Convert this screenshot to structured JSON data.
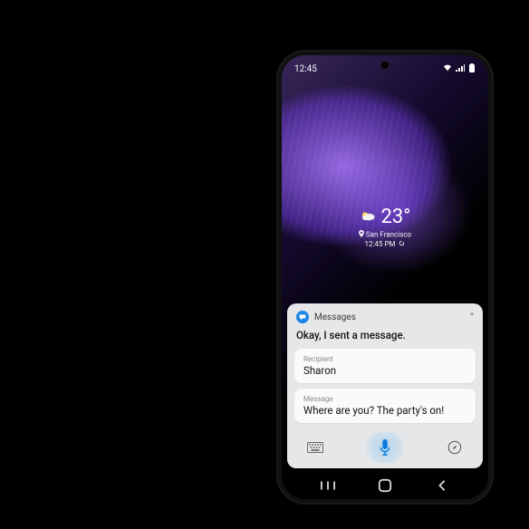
{
  "statusbar": {
    "time": "12:45"
  },
  "widget": {
    "temperature": "23°",
    "location": "San Francisco",
    "time": "12:45 PM"
  },
  "panel": {
    "app_name": "Messages",
    "assistant_reply": "Okay, I sent a message.",
    "recipient": {
      "label": "Recipient",
      "value": "Sharon"
    },
    "message": {
      "label": "Message",
      "value": "Where are you? The party's on!"
    }
  }
}
